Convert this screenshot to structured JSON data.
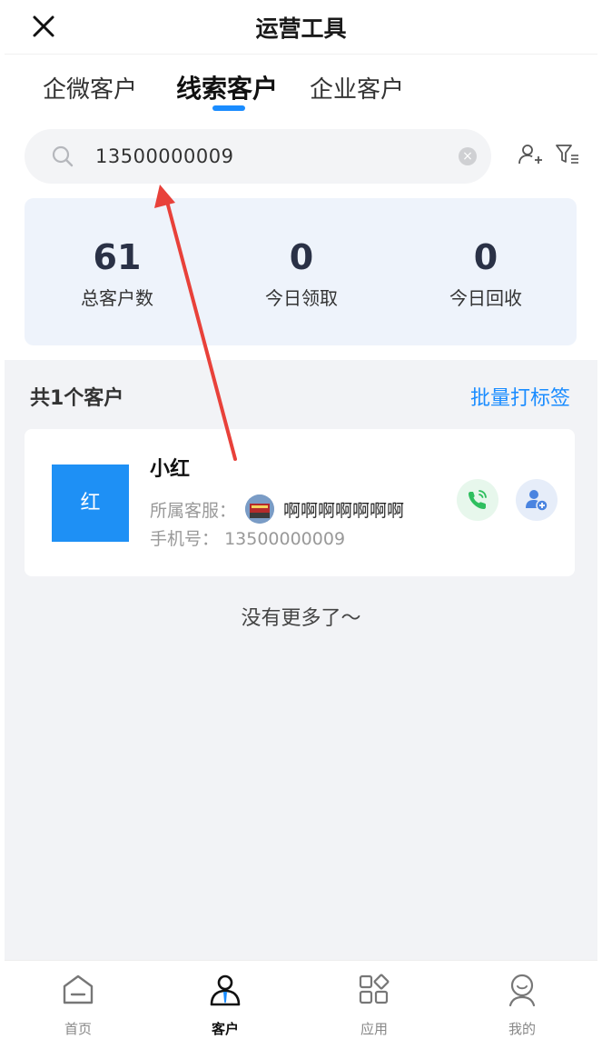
{
  "header": {
    "title": "运营工具"
  },
  "tabs": [
    {
      "label": "企微客户"
    },
    {
      "label": "线索客户"
    },
    {
      "label": "企业客户"
    }
  ],
  "search": {
    "value": "13500000009"
  },
  "stats": [
    {
      "value": "61",
      "label": "总客户数"
    },
    {
      "value": "0",
      "label": "今日领取"
    },
    {
      "value": "0",
      "label": "今日回收"
    }
  ],
  "list": {
    "count_text": "共1个客户",
    "batch_tag_label": "批量打标签",
    "customer": {
      "avatar_text": "红",
      "name": "小红",
      "owner_label": "所属客服：",
      "owner_name": "啊啊啊啊啊啊啊",
      "phone_label": "手机号：",
      "phone": "13500000009"
    },
    "end_text": "没有更多了～"
  },
  "bottom_nav": [
    {
      "label": "首页",
      "icon": "home-icon"
    },
    {
      "label": "客户",
      "icon": "customer-icon"
    },
    {
      "label": "应用",
      "icon": "apps-icon"
    },
    {
      "label": "我的",
      "icon": "profile-icon"
    }
  ],
  "colors": {
    "accent": "#1a8cff",
    "avatar": "#1e90f5",
    "stats_bg": "#eef3fb",
    "annotation": "#e8413a"
  }
}
